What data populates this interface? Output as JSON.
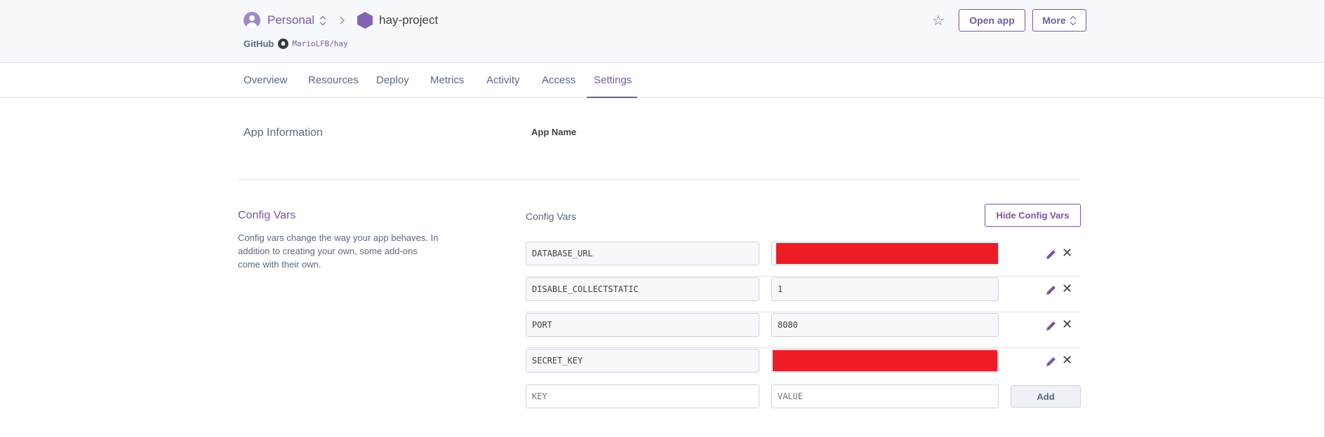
{
  "breadcrumb": {
    "account": "Personal",
    "project": "hay-project"
  },
  "github": {
    "label": "GitHub",
    "repo": "MarioLFB/hay"
  },
  "header_buttons": {
    "open_app": "Open app",
    "more": "More"
  },
  "tabs": [
    {
      "label": "Overview"
    },
    {
      "label": "Resources"
    },
    {
      "label": "Deploy"
    },
    {
      "label": "Metrics"
    },
    {
      "label": "Activity"
    },
    {
      "label": "Access"
    },
    {
      "label": "Settings",
      "active": true
    }
  ],
  "app_info": {
    "section_title": "App Information",
    "field_label": "App Name"
  },
  "config_vars": {
    "section_title": "Config Vars",
    "description": "Config vars change the way your app behaves. In addition to creating your own, some add-ons come with their own.",
    "panel_label": "Config Vars",
    "hide_button": "Hide Config Vars",
    "rows": [
      {
        "key": "DATABASE_URL",
        "value": "",
        "redacted": true
      },
      {
        "key": "DISABLE_COLLECTSTATIC",
        "value": "1",
        "redacted": false
      },
      {
        "key": "PORT",
        "value": "8080",
        "redacted": false
      },
      {
        "key": "SECRET_KEY",
        "value": "",
        "redacted": true
      }
    ],
    "new_var": {
      "key_placeholder": "KEY",
      "value_placeholder": "VALUE",
      "add_button": "Add"
    }
  },
  "colors": {
    "accent": "#79589f",
    "redaction": "#ee1c24"
  },
  "icons": [
    "user-avatar-icon",
    "updown-chevron-icon",
    "chevron-right-icon",
    "app-hexagon-icon",
    "github-icon",
    "star-icon",
    "pencil-icon",
    "close-icon"
  ]
}
